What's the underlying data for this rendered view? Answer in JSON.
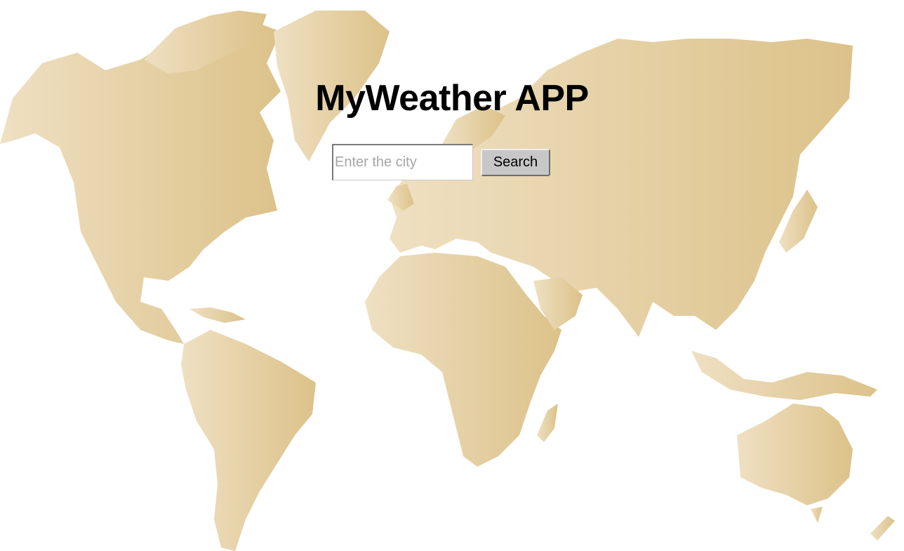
{
  "app": {
    "title": "MyWeather APP"
  },
  "search": {
    "placeholder": "Enter the city",
    "value": "",
    "button_label": "Search"
  },
  "background": {
    "image": "world-map",
    "color_left": "#efe0c3",
    "color_right": "#dcc289"
  }
}
